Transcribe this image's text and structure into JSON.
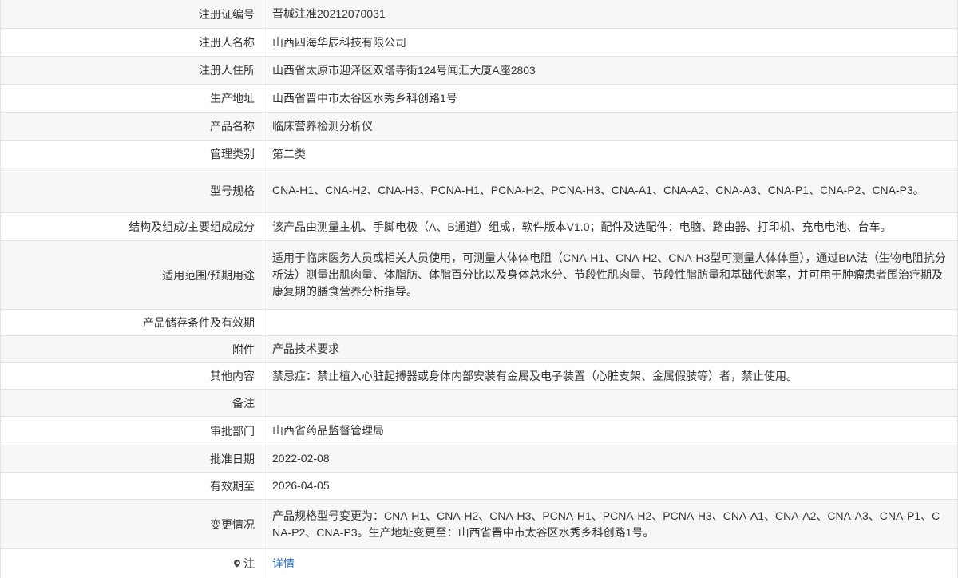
{
  "rows": [
    {
      "label": "注册证编号",
      "value": "晋械注准20212070031"
    },
    {
      "label": "注册人名称",
      "value": "山西四海华辰科技有限公司"
    },
    {
      "label": "注册人住所",
      "value": "山西省太原市迎泽区双塔寺街124号闻汇大厦A座2803"
    },
    {
      "label": "生产地址",
      "value": "山西省晋中市太谷区水秀乡科创路1号"
    },
    {
      "label": "产品名称",
      "value": "临床营养检测分析仪"
    },
    {
      "label": "管理类别",
      "value": "第二类"
    },
    {
      "label": "型号规格",
      "value": "CNA-H1、CNA-H2、CNA-H3、PCNA-H1、PCNA-H2、PCNA-H3、CNA-A1、CNA-A2、CNA-A3、CNA-P1、CNA-P2、CNA-P3。"
    },
    {
      "label": "结构及组成/主要组成成分",
      "value": "该产品由测量主机、手脚电极（A、B通道）组成，软件版本V1.0；配件及选配件：电脑、路由器、打印机、充电电池、台车。"
    },
    {
      "label": "适用范围/预期用途",
      "value": "适用于临床医务人员或相关人员使用，可测量人体体电阻（CNA-H1、CNA-H2、CNA-H3型可测量人体体重），通过BIA法（生物电阻抗分析法）测量出肌肉量、体脂肪、体脂百分比以及身体总水分、节段性肌肉量、节段性脂肪量和基础代谢率，并可用于肿瘤患者围治疗期及康复期的膳食营养分析指导。"
    },
    {
      "label": "产品储存条件及有效期",
      "value": ""
    },
    {
      "label": "附件",
      "value": "产品技术要求"
    },
    {
      "label": "其他内容",
      "value": "禁忌症：禁止植入心脏起搏器或身体内部安装有金属及电子装置（心脏支架、金属假肢等）者，禁止使用。"
    },
    {
      "label": "备注",
      "value": ""
    },
    {
      "label": "审批部门",
      "value": "山西省药品监督管理局"
    },
    {
      "label": "批准日期",
      "value": "2022-02-08"
    },
    {
      "label": "有效期至",
      "value": "2026-04-05"
    },
    {
      "label": "变更情况",
      "value": "产品规格型号变更为：CNA-H1、CNA-H2、CNA-H3、PCNA-H1、PCNA-H2、PCNA-H3、CNA-A1、CNA-A2、CNA-A3、CNA-P1、CNA-P2、CNA-P3。生产地址变更至：山西省晋中市太谷区水秀乡科创路1号。"
    }
  ],
  "note": {
    "icon": "pin-icon",
    "label": "注",
    "link_text": "详情"
  },
  "colors": {
    "link": "#2b6fc2",
    "border": "#e2e2e2",
    "stripe": "#f7f7f7"
  }
}
